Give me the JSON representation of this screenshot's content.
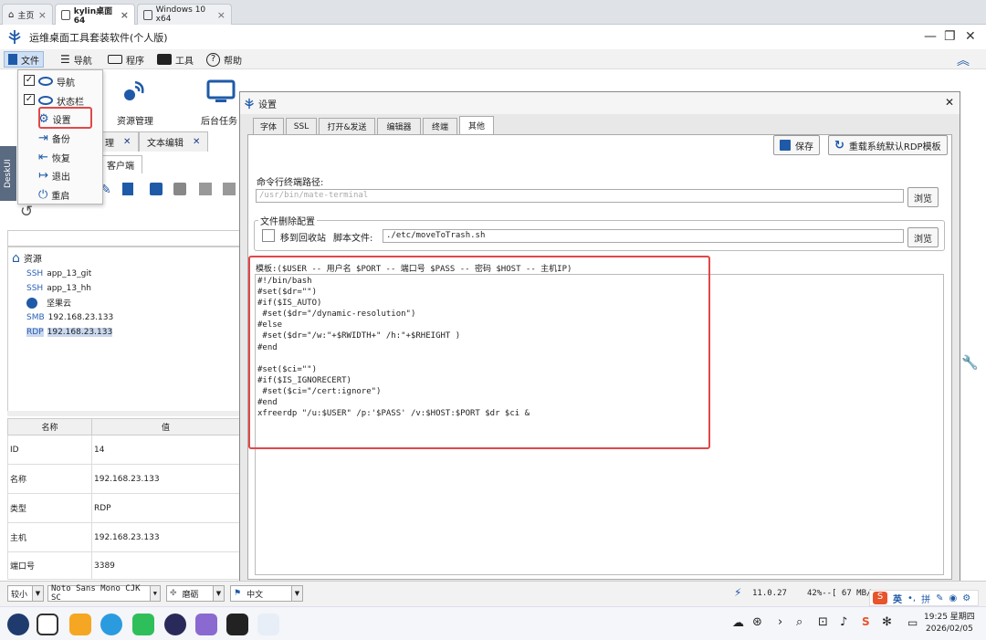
{
  "vm_tabs": [
    {
      "label": "主页"
    },
    {
      "label": "kylin桌面64"
    },
    {
      "label": "Windows 10 x64"
    }
  ],
  "app": {
    "title": "运维桌面工具套装软件(个人版)"
  },
  "menu": {
    "file": "文件",
    "nav": "导航",
    "program": "程序",
    "tools": "工具",
    "help": "帮助"
  },
  "file_menu": [
    {
      "label": "导航",
      "checked": true
    },
    {
      "label": "状态栏",
      "checked": true
    },
    {
      "label": "设置"
    },
    {
      "label": "备份"
    },
    {
      "label": "恢复"
    },
    {
      "label": "退出"
    },
    {
      "label": "重启"
    }
  ],
  "toolbar": {
    "resource_label": "资源管理",
    "background_label": "后台任务"
  },
  "side_label": "DeskUI",
  "left_tabs": {
    "tab1": "理",
    "tab2": "文本编辑",
    "subtab": "客户端"
  },
  "tree": {
    "root": "资源",
    "items": [
      {
        "tag": "SSH",
        "label": "app_13_git"
      },
      {
        "tag": "SSH",
        "label": "app_13_hh"
      },
      {
        "tag": "",
        "label": "坚果云"
      },
      {
        "tag": "SMB",
        "label": "192.168.23.133"
      },
      {
        "tag": "RDP",
        "label": "192.168.23.133"
      }
    ]
  },
  "props": {
    "headers": [
      "名称",
      "值"
    ],
    "rows": [
      {
        "k": "ID",
        "v": "14"
      },
      {
        "k": "名称",
        "v": "192.168.23.133"
      },
      {
        "k": "类型",
        "v": "RDP"
      },
      {
        "k": "主机",
        "v": "192.168.23.133"
      },
      {
        "k": "端口号",
        "v": "3389"
      }
    ]
  },
  "settings": {
    "title": "设置",
    "tabs": [
      "字体",
      "SSL",
      "打开&发送",
      "编辑器",
      "终端",
      "其他"
    ],
    "save": "保存",
    "reload": "重载系统默认RDP模板",
    "terminal_path_label": "命令行终端路径:",
    "terminal_path_placeholder": "/usr/bin/mate-terminal",
    "browse": "浏览",
    "delete_group": "文件删除配置",
    "move_to_trash": "移到回收站",
    "script_label": "脚本文件:",
    "script_value": "./etc/moveToTrash.sh",
    "template_header": "模板:($USER -- 用户名   $PORT -- 端口号   $PASS -- 密码   $HOST -- 主机IP)",
    "template": "#!/bin/bash\n#set($dr=\"\")\n#if($IS_AUTO)\n #set($dr=\"/dynamic-resolution\")\n#else\n #set($dr=\"/w:\"+$RWIDTH+\" /h:\"+$RHEIGHT )\n#end\n\n#set($ci=\"\")\n#if($IS_IGNORECERT)\n #set($ci=\"/cert:ignore\")\n#end\nxfreerdp \"/u:$USER\" /p:'$PASS' /v:$HOST:$PORT $dr $ci &"
  },
  "bottom": {
    "size": "较小",
    "font": "Noto Sans Mono CJK SC",
    "theme": "磨砺",
    "lang": "中文",
    "version": "11.0.27",
    "memory": "42%--[ 67 MB/"
  },
  "tray": {
    "ime": "英",
    "pin": "拼",
    "time": "19:25 星期四",
    "date": "2026/02/05"
  }
}
